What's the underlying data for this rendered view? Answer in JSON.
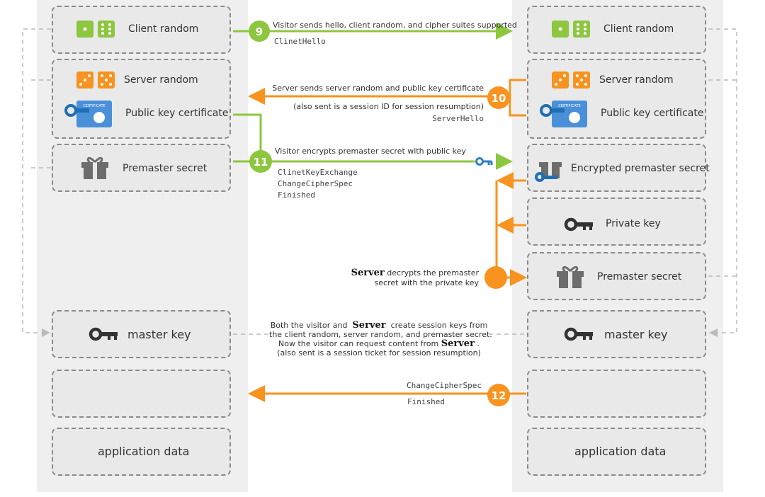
{
  "colors": {
    "green": "#8dc63f",
    "orange": "#f7931e",
    "blue": "#2f7fc1",
    "gray": "#666666"
  },
  "client": {
    "client_random": "Client random",
    "server_random": "Server random",
    "public_key_certificate": "Public key certificate",
    "certificate_badge": "CERTIFICATE",
    "premaster_secret": "Premaster secret",
    "master_key": "master key",
    "application_data": "application data"
  },
  "server": {
    "client_random": "Client random",
    "server_random": "Server random",
    "public_key_certificate": "Public key certificate",
    "certificate_badge": "CERTIFICATE",
    "encrypted_premaster_secret": "Encrypted premaster secret",
    "private_key": "Private key",
    "premaster_secret": "Premaster secret",
    "master_key": "master key",
    "application_data": "application data"
  },
  "steps": {
    "s9": {
      "num": "9",
      "text": "Visitor sends hello, client random, and cipher suites supported",
      "msg": "ClinetHello"
    },
    "s10": {
      "num": "10",
      "text": "Server sends server random and public key certificate",
      "note": "(also sent is a session ID for session resumption)",
      "msg": "ServerHello"
    },
    "s11": {
      "num": "11",
      "text": "Visitor encrypts premaster secret with public key",
      "msgs": [
        "ClinetKeyExchange",
        "ChangeCipherSpec",
        "Finished"
      ]
    },
    "decrypt": {
      "server": "Server",
      "line1": "decrypts the premaster",
      "line2": "secret with the private key"
    },
    "session": {
      "a": "Both the visitor and",
      "server": "Server",
      "b": "create session keys from",
      "line2": "the client random, server random, and premaster secret.",
      "line3": "Now the visitor can request content from",
      "server2": "Server",
      "dot": ".",
      "line4": "(also sent is a session ticket for session resumption)"
    },
    "s12": {
      "num": "12",
      "msgs": [
        "ChangeCipherSpec",
        "Finished"
      ]
    }
  }
}
